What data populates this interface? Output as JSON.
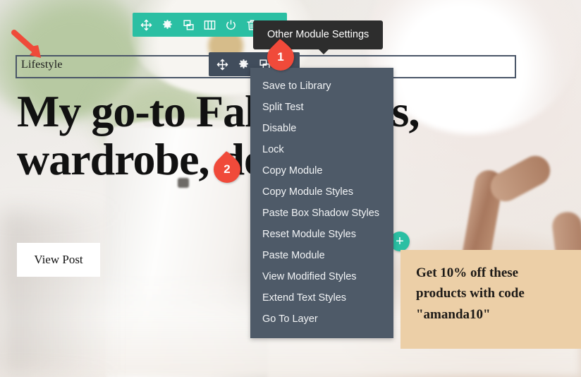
{
  "page": {
    "eyebrow": "Lifestyle",
    "headline": "My go-to Fall recipes, wardrobe, decor",
    "view_post_label": "View Post",
    "promo_text": "Get 10% off these products with code \"amanda10\"",
    "add_label": "+"
  },
  "row_toolbar": {
    "icons": [
      {
        "name": "move-icon",
        "title": "Move Row"
      },
      {
        "name": "gear-icon",
        "title": "Row Settings"
      },
      {
        "name": "duplicate-icon",
        "title": "Duplicate Row"
      },
      {
        "name": "columns-icon",
        "title": "Change Column Structure"
      },
      {
        "name": "power-icon",
        "title": "Save Row to Library"
      },
      {
        "name": "trash-icon",
        "title": "Delete Row"
      },
      {
        "name": "more-dots-icon",
        "title": "Other Row Settings"
      }
    ]
  },
  "module_toolbar": {
    "icons": [
      {
        "name": "move-icon",
        "title": "Move Module"
      },
      {
        "name": "gear-icon",
        "title": "Module Settings"
      },
      {
        "name": "duplicate-icon",
        "title": "Duplicate Module"
      },
      {
        "name": "more-dots-icon",
        "title": "Other Module Settings"
      }
    ]
  },
  "tooltip": {
    "text": "Other Module Settings"
  },
  "context_menu": {
    "items": [
      {
        "label": "Save to Library"
      },
      {
        "label": "Split Test"
      },
      {
        "label": "Disable"
      },
      {
        "label": "Lock"
      },
      {
        "label": "Copy Module"
      },
      {
        "label": "Copy Module Styles"
      },
      {
        "label": "Paste Box Shadow Styles"
      },
      {
        "label": "Reset Module Styles"
      },
      {
        "label": "Paste Module"
      },
      {
        "label": "View Modified Styles"
      },
      {
        "label": "Extend Text Styles"
      },
      {
        "label": "Go To Layer"
      }
    ]
  },
  "annotations": {
    "callout_1": "1",
    "callout_2": "2"
  },
  "colors": {
    "row_toolbar": "#2bbfa3",
    "module_toolbar": "#414d5c",
    "menu_background": "#4e5a68",
    "tooltip_background": "#2d2d2d",
    "callout": "#f04a3a",
    "promo_background": "#eccfa7",
    "module_outline": "#4a5668"
  }
}
